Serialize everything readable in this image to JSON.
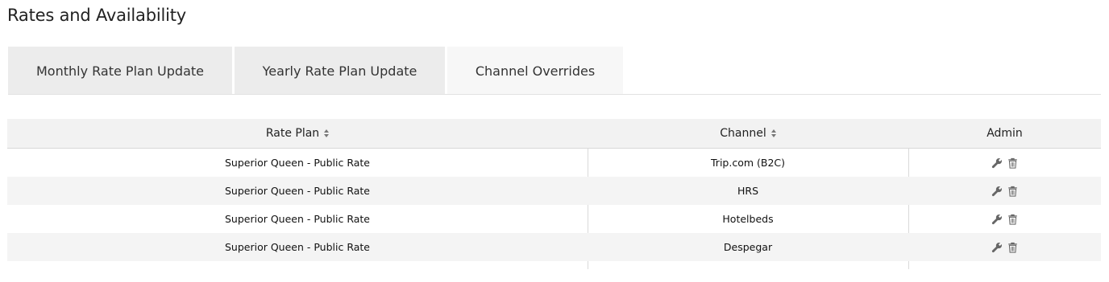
{
  "page": {
    "title": "Rates and Availability"
  },
  "tabs": [
    {
      "label": "Monthly Rate Plan Update",
      "active": false
    },
    {
      "label": "Yearly Rate Plan Update",
      "active": false
    },
    {
      "label": "Channel Overrides",
      "active": true
    }
  ],
  "table": {
    "columns": [
      {
        "label": "Rate Plan",
        "sortable": true
      },
      {
        "label": "Channel",
        "sortable": true
      },
      {
        "label": "Admin",
        "sortable": false
      }
    ],
    "rows": [
      {
        "rate_plan": "Superior Queen - Public Rate",
        "channel": "Trip.com (B2C)",
        "actions": [
          "wrench-icon",
          "trash-icon"
        ]
      },
      {
        "rate_plan": "Superior Queen - Public Rate",
        "channel": "HRS",
        "actions": [
          "wrench-icon",
          "trash-icon"
        ]
      },
      {
        "rate_plan": "Superior Queen - Public Rate",
        "channel": "Hotelbeds",
        "actions": [
          "wrench-icon",
          "trash-icon"
        ]
      },
      {
        "rate_plan": "Superior Queen - Public Rate",
        "channel": "Despegar",
        "actions": [
          "wrench-icon",
          "trash-icon"
        ]
      }
    ]
  },
  "colors": {
    "tab_inactive": "#ececec",
    "tab_active": "#f7f7f7",
    "header_bg": "#f2f2f2",
    "row_alt_bg": "#f4f4f4",
    "icon": "#666666"
  }
}
